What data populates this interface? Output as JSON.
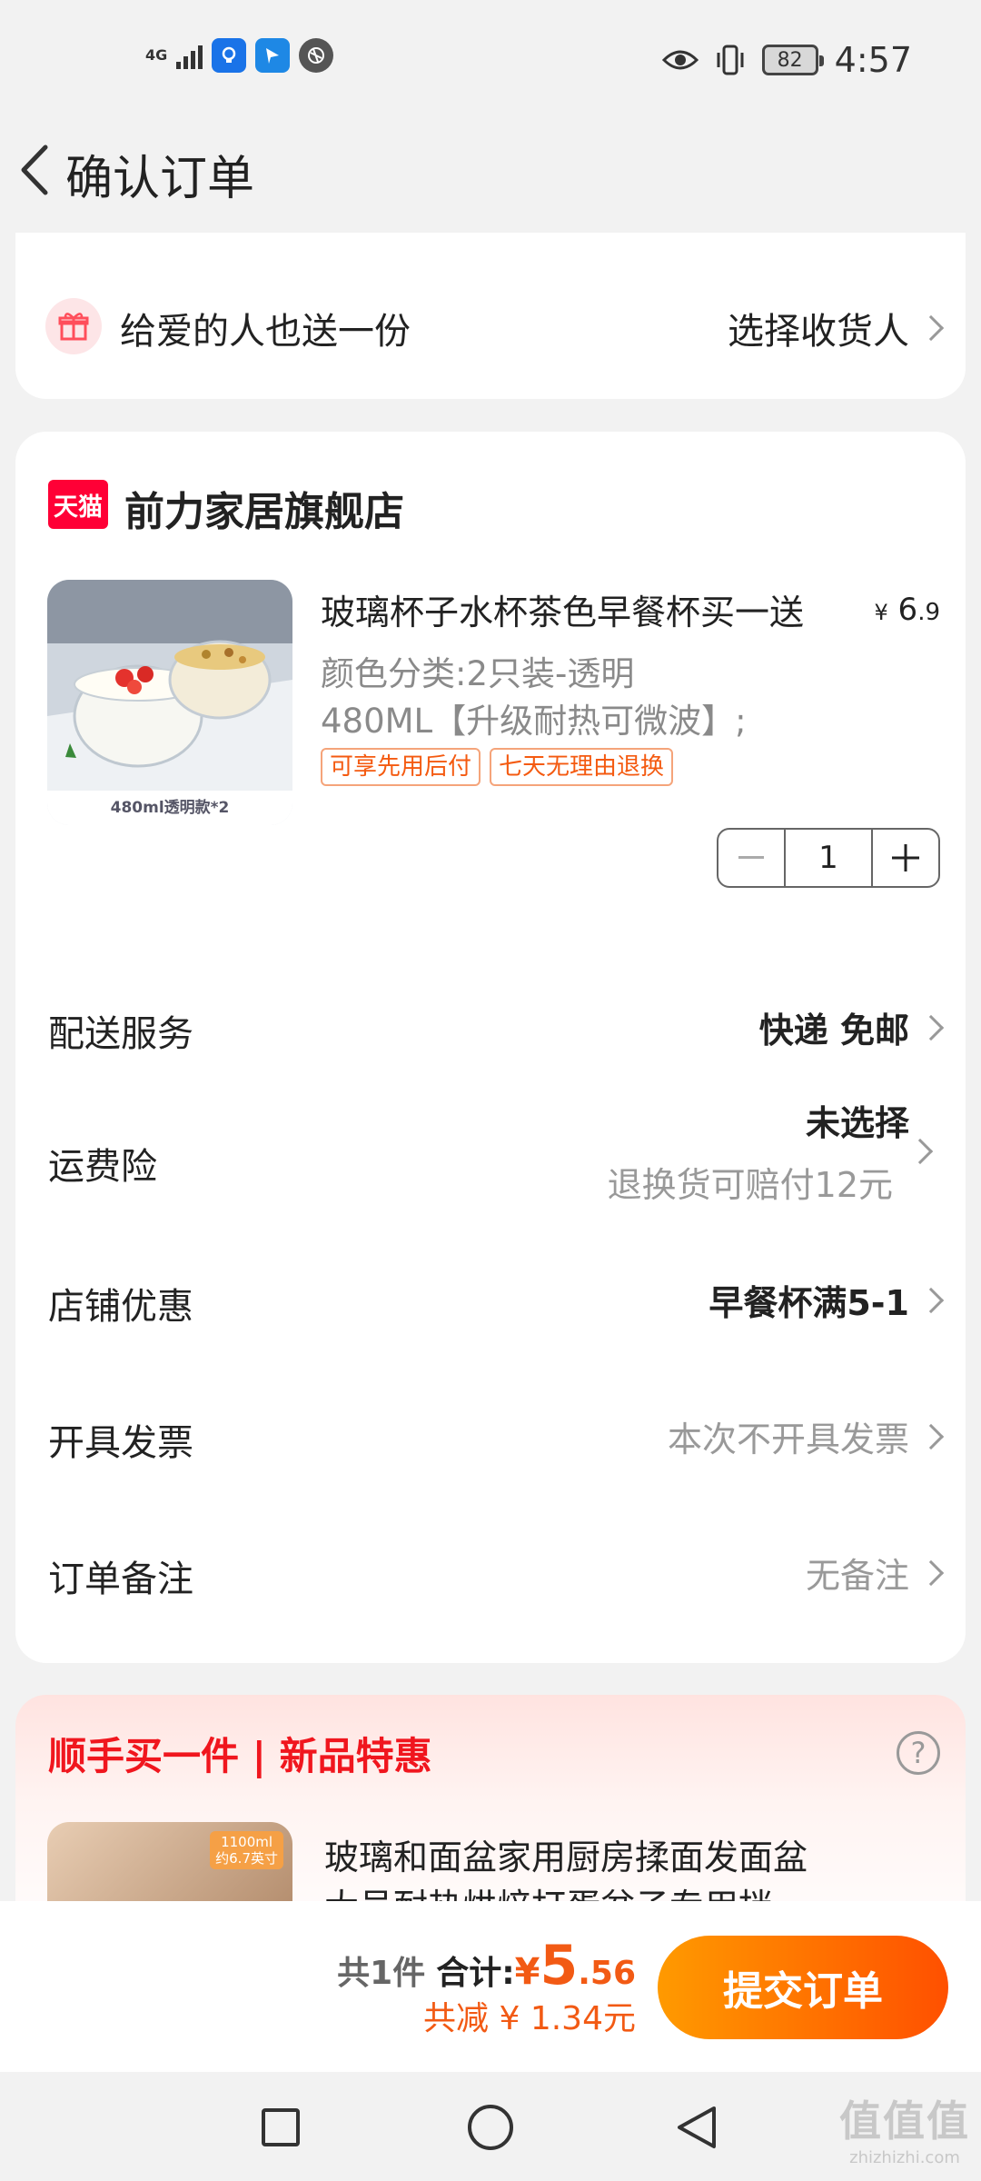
{
  "status_bar": {
    "network": "4G",
    "battery": "82",
    "time": "4:57"
  },
  "header": {
    "title": "确认订单"
  },
  "gift": {
    "text": "给爱的人也送一份",
    "action": "选择收货人"
  },
  "store": {
    "badge": "天猫",
    "name": "前力家居旗舰店"
  },
  "product": {
    "title": "玻璃杯子水杯茶色早餐杯买一送",
    "price_symbol": "¥",
    "price_int": "6",
    "price_dec": ".9",
    "spec_line1": "颜色分类:2只装-透明",
    "spec_line2": "480ML【升级耐热可微波】;",
    "image_caption": "480ml透明款*2",
    "tags": [
      "可享先用后付",
      "七天无理由退换"
    ],
    "quantity": "1"
  },
  "rows": {
    "delivery": {
      "label": "配送服务",
      "value": "快递 免邮"
    },
    "insurance": {
      "label": "运费险",
      "value": "未选择",
      "sub": "退换货可赔付12元"
    },
    "discount": {
      "label": "店铺优惠",
      "value": "早餐杯满5-1"
    },
    "invoice": {
      "label": "开具发票",
      "value": "本次不开具发票"
    },
    "note": {
      "label": "订单备注",
      "value": "无备注"
    }
  },
  "recommendation": {
    "title": "顺手买一件 | 新品特惠",
    "help_icon": "?",
    "badge_line1": "1100ml",
    "badge_line2": "约6.7英寸",
    "name_line1": "玻璃和面盆家用厨房揉面发面盆",
    "name_line2": "大号耐热烘焙打蛋盆子专用拌"
  },
  "summary": {
    "count": "共1件",
    "total_label": "合计:",
    "currency": "¥",
    "total_int": "5",
    "total_dec": ".56",
    "saved": "共减 ¥ 1.34元",
    "submit": "提交订单"
  },
  "watermark": {
    "logo": "值值值",
    "url": "zhizhizhi.com"
  },
  "colors": {
    "accent": "#ff5000",
    "price": "#f25a14",
    "tmall": "#ff0036",
    "reco_title": "#f0161e"
  }
}
